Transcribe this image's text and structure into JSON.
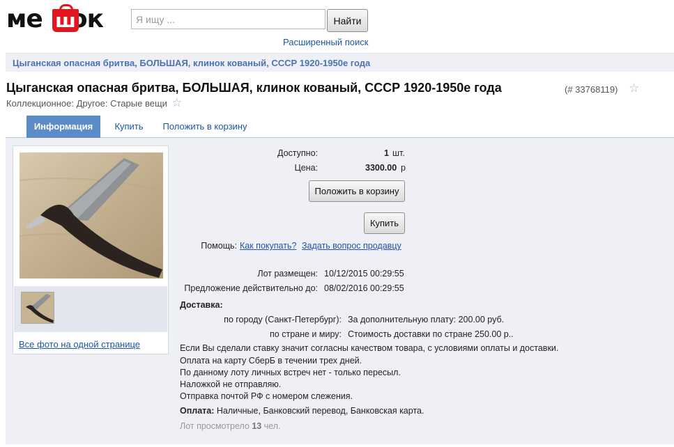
{
  "header": {
    "logo_text_left": "ме",
    "logo_bag_letter": "ш",
    "logo_text_right": "ок",
    "search_placeholder": "Я ищу ...",
    "search_button": "Найти",
    "advanced_search": "Расширенный поиск"
  },
  "breadcrumb": "Цыганская опасная бритва, БОЛЬШАЯ, клинок кованый, СССР 1920-1950е года",
  "product": {
    "title": "Цыганская опасная бритва, БОЛЬШАЯ, клинок кованый, СССР 1920-1950е года",
    "lot_number": "(# 33768119)",
    "category": "Коллекционное: Другое: Старые вещи"
  },
  "tabs": [
    "Информация",
    "Купить",
    "Положить в корзину"
  ],
  "gallery": {
    "all_photos_link": "Все фото на одной странице"
  },
  "details": {
    "available_label": "Доступно:",
    "available_value": "1",
    "available_unit": "шт.",
    "price_label": "Цена:",
    "price_value": "3300.00",
    "price_unit": "р",
    "add_to_cart_button": "Положить в корзину",
    "buy_button": "Купить",
    "help_label": "Помощь:",
    "help_link_1": "Как покупать?",
    "help_link_2": "Задать вопрос продавцу",
    "posted_label": "Лот размещен:",
    "posted_value": "10/12/2015 00:29:55",
    "valid_label": "Предложение действительно до:",
    "valid_value": "08/02/2016 00:29:55"
  },
  "delivery": {
    "heading": "Доставка:",
    "city_label": "по городу (Санкт-Петербург):",
    "city_value": "За дополнительную плату: 200.00 руб.",
    "country_label": "по стране и миру:",
    "country_value": "Стоимость доставки по стране 250.00 р..",
    "notes": [
      "Если Вы сделали ставку значит согласны качеством товара, с условиями оплаты и доставки.",
      "Оплата на карту СберБ в течении трех дней.",
      "По данному лоту личных встреч нет - только пересыл.",
      "Наложкой не отправляю.",
      "Отправка почтой РФ с номером слежения."
    ]
  },
  "payment": {
    "label": "Оплата:",
    "value": "Наличные, Банковский перевод, Банковская карта."
  },
  "views": {
    "prefix": "Лот просмотрело",
    "count": "13",
    "suffix": "чел."
  }
}
